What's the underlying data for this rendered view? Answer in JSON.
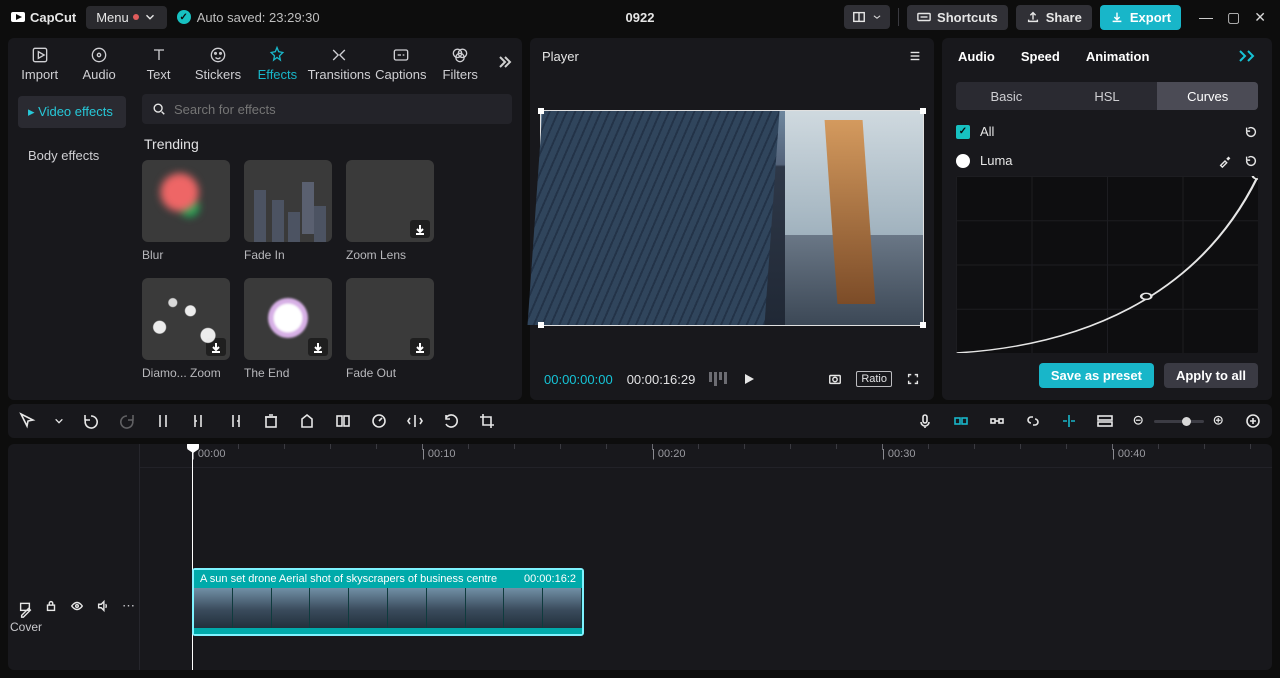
{
  "app": {
    "name": "CapCut",
    "menu_label": "Menu",
    "autosave": "Auto saved: 23:29:30",
    "project_title": "0922",
    "shortcuts": "Shortcuts",
    "share": "Share",
    "export": "Export"
  },
  "left_tabs": {
    "items": [
      "Import",
      "Audio",
      "Text",
      "Stickers",
      "Effects",
      "Transitions",
      "Captions",
      "Filters"
    ],
    "active_index": 4
  },
  "subnav": {
    "items": [
      "Video effects",
      "Body effects"
    ],
    "active_index": 0
  },
  "search": {
    "placeholder": "Search for effects"
  },
  "section": {
    "trending": "Trending"
  },
  "effects": [
    {
      "label": "Blur",
      "thumb": "tBlur",
      "downloadable": false
    },
    {
      "label": "Fade In",
      "thumb": "tCity",
      "downloadable": false
    },
    {
      "label": "Zoom Lens",
      "thumb": "tZoom",
      "downloadable": true
    },
    {
      "label": "Diamo... Zoom",
      "thumb": "tDiamond",
      "downloadable": true
    },
    {
      "label": "The End",
      "thumb": "tEnd",
      "downloadable": true
    },
    {
      "label": "Fade Out",
      "thumb": "tFog",
      "downloadable": true
    }
  ],
  "player": {
    "title": "Player",
    "current": "00:00:00:00",
    "total": "00:00:16:29",
    "ratio_label": "Ratio"
  },
  "inspector": {
    "tabs": [
      "Audio",
      "Speed",
      "Animation"
    ],
    "curves_tabs": [
      "Basic",
      "HSL",
      "Curves"
    ],
    "curves_active_index": 2,
    "all_label": "All",
    "luma_label": "Luma",
    "save_preset": "Save as preset",
    "apply_all": "Apply to all"
  },
  "ruler": {
    "marks": [
      "00:00",
      "00:10",
      "00:20",
      "00:30",
      "00:40"
    ]
  },
  "clip": {
    "title": "A sun set drone Aerial shot of skyscrapers of  business centre",
    "duration": "00:00:16:2"
  },
  "cover_label": "Cover"
}
